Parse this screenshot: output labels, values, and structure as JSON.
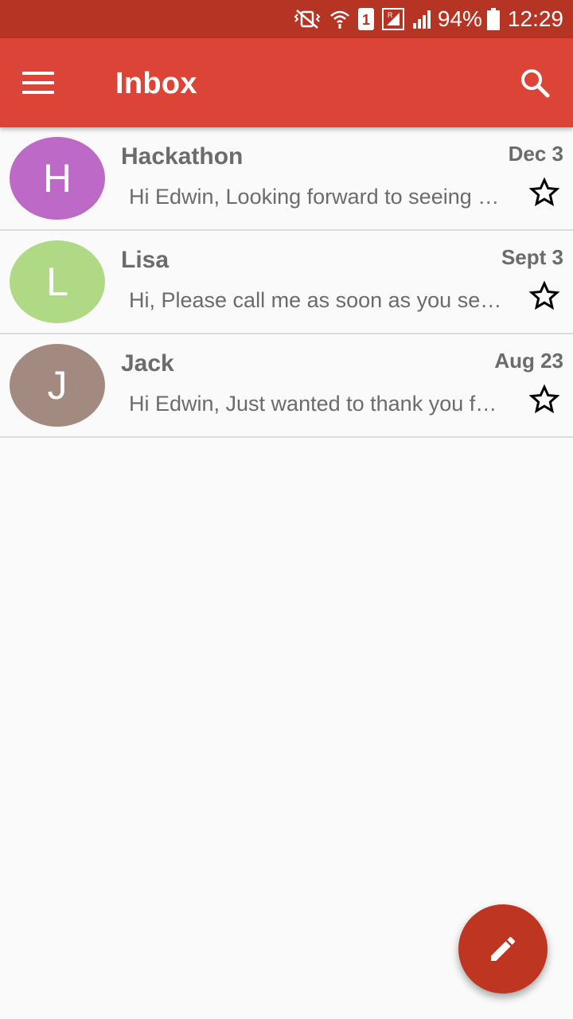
{
  "status_bar": {
    "battery_percent": "94%",
    "time": "12:29",
    "sim_badge": "1",
    "icons": [
      "vibrate-off-icon",
      "wifi-icon",
      "sim-1-icon",
      "roaming-signal-icon",
      "signal-icon",
      "battery-icon"
    ]
  },
  "app_bar": {
    "title": "Inbox",
    "menu_icon": "menu-icon",
    "search_icon": "search-icon"
  },
  "emails": [
    {
      "initial": "H",
      "avatar_color": "#bd69c7",
      "sender": "Hackathon",
      "date": "Dec 3",
      "preview": "Hi Edwin, Looking forward to seeing you at the hackathon",
      "starred": false
    },
    {
      "initial": "L",
      "avatar_color": "#b0d985",
      "sender": "Lisa",
      "date": "Sept 3",
      "preview": "Hi, Please call me as soon as you see this message",
      "starred": false
    },
    {
      "initial": "J",
      "avatar_color": "#a38a81",
      "sender": "Jack",
      "date": "Aug 23",
      "preview": "Hi Edwin, Just wanted to thank you for your help",
      "starred": false
    }
  ],
  "fab": {
    "icon": "pencil-icon"
  },
  "colors": {
    "status_bar": "#b63424",
    "app_bar": "#dc4437",
    "fab": "#be3522",
    "background": "#fafafa"
  }
}
